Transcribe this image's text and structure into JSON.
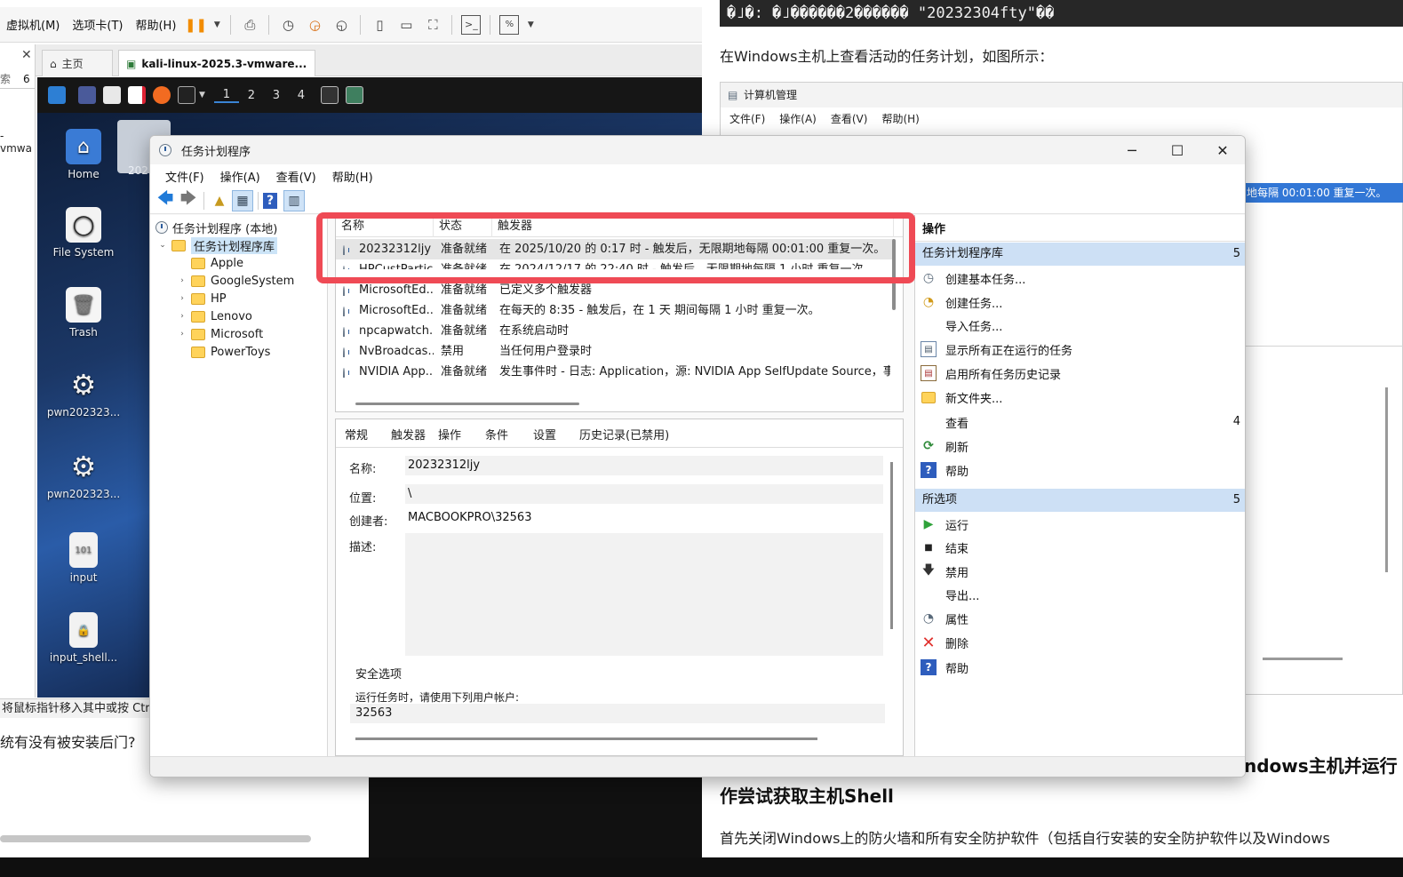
{
  "vmware": {
    "menu": [
      "虚拟机(M)",
      "选项卡(T)",
      "帮助(H)"
    ],
    "tabs": [
      {
        "label": "主页"
      },
      {
        "label": "kali-linux-2025.3-vmware..."
      }
    ],
    "sidebar": {
      "search_fragment": "索",
      "count": "6",
      "item_fragment": "-vmwa"
    },
    "kali_panel": {
      "workspaces": [
        "1",
        "2",
        "3",
        "4"
      ]
    },
    "desktop_icons": [
      {
        "label": "Home"
      },
      {
        "label": "File System"
      },
      {
        "label": "Trash"
      },
      {
        "label": "pwn202323..."
      },
      {
        "label": "pwn202323..."
      },
      {
        "label": "input"
      },
      {
        "label": "input_shell..."
      }
    ],
    "partial_icon_label": "202",
    "status_text": "将鼠标指针移入其中或按 Ctr",
    "below_text": "统有没有被安装后门?"
  },
  "doc": {
    "code_line": "�˩�: �˩������2������ \"20232304fty\"��",
    "para1": "在Windows主机上查看活动的任务计划，如图所示：",
    "embedded": {
      "title": "计算机管理",
      "menu": [
        "文件(F)",
        "操作(A)",
        "查看(V)",
        "帮助(H)"
      ],
      "highlight": "地每隔 00:01:00 重复一次。"
    },
    "heading_tail": "ndows主机并运行",
    "heading2": "作尝试获取主机Shell",
    "para2": "首先关闭Windows上的防火墙和所有安全防护软件（包括自行安装的安全防护软件以及Windows"
  },
  "task_scheduler": {
    "title": "任务计划程序",
    "menu": [
      "文件(F)",
      "操作(A)",
      "查看(V)",
      "帮助(H)"
    ],
    "tree": {
      "root": "任务计划程序 (本地)",
      "library": "任务计划程序库",
      "folders": [
        "Apple",
        "GoogleSystem",
        "HP",
        "Lenovo",
        "Microsoft",
        "PowerToys"
      ]
    },
    "columns": [
      "名称",
      "状态",
      "触发器"
    ],
    "tasks": [
      {
        "name": "20232312ljy",
        "status": "准备就绪",
        "trigger": "在 2025/10/20 的 0:17 时 - 触发后，无限期地每隔 00:01:00 重复一次。"
      },
      {
        "name": "HPCustPartic...",
        "status": "准备就绪",
        "trigger": "在 2024/12/17 的 22:40 时 - 触发后，无限期地每隔 1 小时 重复一次。"
      },
      {
        "name": "MicrosoftEd...",
        "status": "准备就绪",
        "trigger": "已定义多个触发器"
      },
      {
        "name": "MicrosoftEd...",
        "status": "准备就绪",
        "trigger": "在每天的 8:35 - 触发后，在 1 天 期间每隔 1 小时 重复一次。"
      },
      {
        "name": "npcapwatch...",
        "status": "准备就绪",
        "trigger": "在系统启动时"
      },
      {
        "name": "NvBroadcas...",
        "status": "禁用",
        "trigger": "当任何用户登录时"
      },
      {
        "name": "NVIDIA App...",
        "status": "准备就绪",
        "trigger": "发生事件时 - 日志: Application，源: NVIDIA App SelfUpdate Source，事件"
      }
    ],
    "detail": {
      "tabs": [
        "常规",
        "触发器",
        "操作",
        "条件",
        "设置",
        "历史记录(已禁用)"
      ],
      "name_label": "名称:",
      "name_value": "20232312ljy",
      "location_label": "位置:",
      "location_value": "\\",
      "author_label": "创建者:",
      "author_value": "MACBOOKPRO\\32563",
      "desc_label": "描述:",
      "security_title": "安全选项",
      "security_text": "运行任务时，请使用下列用户帐户:",
      "security_user": "32563"
    },
    "actions": {
      "header": "操作",
      "section1": {
        "title": "任务计划程序库",
        "count": "5"
      },
      "items1": [
        "创建基本任务...",
        "创建任务...",
        "导入任务...",
        "显示所有正在运行的任务",
        "启用所有任务历史记录",
        "新文件夹...",
        "查看",
        "刷新",
        "帮助"
      ],
      "view_count": "4",
      "section2": {
        "title": "所选项",
        "count": "5"
      },
      "items2": [
        "运行",
        "结束",
        "禁用",
        "导出...",
        "属性",
        "删除",
        "帮助"
      ]
    }
  }
}
